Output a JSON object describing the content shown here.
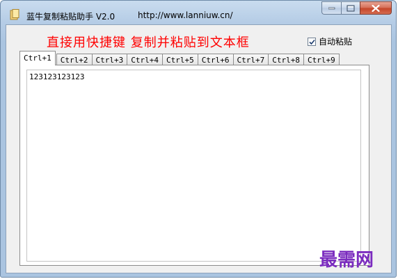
{
  "window": {
    "title": "蓝牛复制粘贴助手 V2.0",
    "url": "http://www.lanniuw.cn/"
  },
  "header": {
    "hotkey_text": "直接用快捷键  复制并粘贴到文本框",
    "auto_paste": {
      "label": "自动粘贴",
      "checked": true
    }
  },
  "tabs": [
    {
      "label": "Ctrl+1",
      "active": true
    },
    {
      "label": "Ctrl+2",
      "active": false
    },
    {
      "label": "Ctrl+3",
      "active": false
    },
    {
      "label": "Ctrl+4",
      "active": false
    },
    {
      "label": "Ctrl+5",
      "active": false
    },
    {
      "label": "Ctrl+6",
      "active": false
    },
    {
      "label": "Ctrl+7",
      "active": false
    },
    {
      "label": "Ctrl+8",
      "active": false
    },
    {
      "label": "Ctrl+9",
      "active": false
    }
  ],
  "panel": {
    "text": "123123123123"
  },
  "watermark": "最需网",
  "colors": {
    "hotkey_text": "#ff0000",
    "watermark": "#7b2cbf",
    "close_button": "#c5462a"
  }
}
